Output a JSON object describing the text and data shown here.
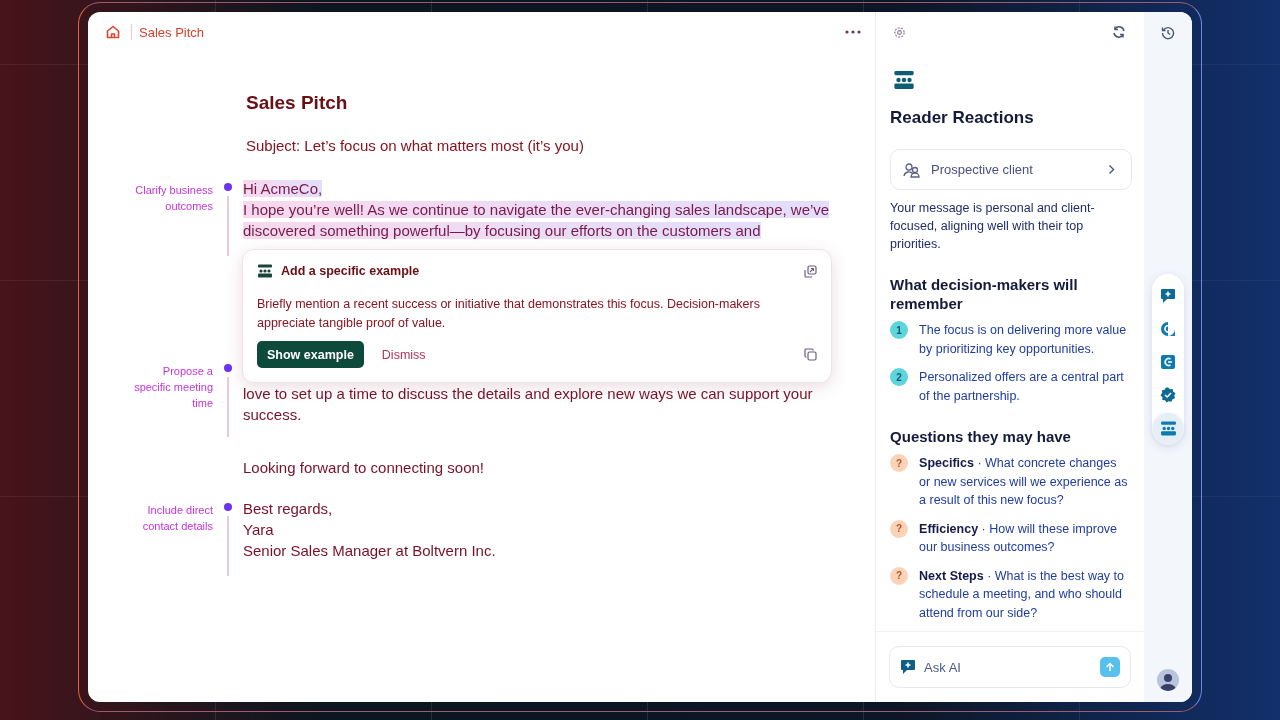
{
  "header": {
    "title": "Sales Pitch"
  },
  "document": {
    "title": "Sales Pitch",
    "subject": "Subject: Let’s focus on what matters most (it’s you)",
    "blocks": [
      {
        "annotation": "Clarify business outcomes",
        "highlighted": true,
        "lines": [
          "Hi AcmeCo,",
          "I hope you’re well! As we continue to navigate the ever-changing sales landscape, we’ve",
          "discovered something powerful—by focusing our efforts on the customers and"
        ],
        "suggestion": {
          "title": "Add a specific example",
          "body": "Briefly mention a recent success or initiative that demonstrates this focus. Decision-makers appreciate tangible proof of value.",
          "primary": "Show example",
          "secondary": "Dismiss"
        }
      },
      {
        "annotation": "Propose a specific meeting time",
        "highlighted": false,
        "lines": [
          "love to set up a time to discuss the details and explore new ways we can support your",
          "success."
        ]
      },
      {
        "highlighted": false,
        "lines": [
          "Looking forward to connecting soon!"
        ]
      },
      {
        "annotation": "Include direct contact details",
        "highlighted": false,
        "lines": [
          "Best regards,",
          "Yara",
          "Senior Sales Manager at Boltvern Inc."
        ]
      }
    ]
  },
  "panel": {
    "title": "Reader Reactions",
    "persona": "Prospective client",
    "summary": "Your message is personal and client-focused, aligning well with their top priorities.",
    "remember_heading": "What decision-makers will remember",
    "remember": [
      {
        "number": "1",
        "text": "The focus is on delivering more value by prioritizing key opportunities."
      },
      {
        "number": "2",
        "text": "Personalized offers are a central part of the partnership."
      }
    ],
    "questions_heading": "Questions they may have",
    "questions": [
      {
        "mark": "?",
        "topic": "Specifics",
        "text": " · What concrete changes or new services will we experience as a result of this new focus?"
      },
      {
        "mark": "?",
        "topic": "Efficiency",
        "text": " · How will these improve our business outcomes?"
      },
      {
        "mark": "?",
        "topic": "Next Steps",
        "text": " · What is the best way to schedule a meeting, and who should attend from our side?"
      }
    ],
    "ask": {
      "placeholder": "Ask AI"
    }
  },
  "rail": {
    "tools": [
      {
        "kind": "chat",
        "selected": false
      },
      {
        "kind": "grammar",
        "selected": false
      },
      {
        "kind": "rewrite",
        "selected": false
      },
      {
        "kind": "verify",
        "selected": false
      },
      {
        "kind": "audience",
        "selected": true
      }
    ]
  }
}
